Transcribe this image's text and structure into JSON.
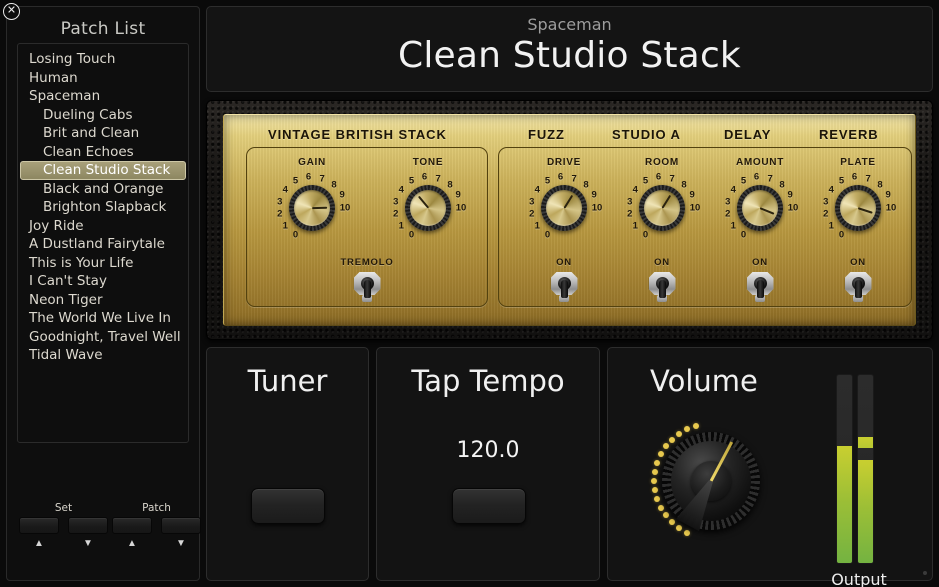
{
  "window": {
    "close_icon": "close-icon"
  },
  "sidebar": {
    "title": "Patch List",
    "items": [
      {
        "label": "Losing Touch",
        "child": false,
        "selected": false
      },
      {
        "label": "Human",
        "child": false,
        "selected": false
      },
      {
        "label": "Spaceman",
        "child": false,
        "selected": false
      },
      {
        "label": "Dueling Cabs",
        "child": true,
        "selected": false
      },
      {
        "label": "Brit and Clean",
        "child": true,
        "selected": false
      },
      {
        "label": "Clean Echoes",
        "child": true,
        "selected": false
      },
      {
        "label": "Clean Studio Stack",
        "child": true,
        "selected": true
      },
      {
        "label": "Black and Orange",
        "child": true,
        "selected": false
      },
      {
        "label": "Brighton Slapback",
        "child": true,
        "selected": false
      },
      {
        "label": "Joy Ride",
        "child": false,
        "selected": false
      },
      {
        "label": "A Dustland Fairytale",
        "child": false,
        "selected": false
      },
      {
        "label": "This is Your Life",
        "child": false,
        "selected": false
      },
      {
        "label": "I Can't Stay",
        "child": false,
        "selected": false
      },
      {
        "label": "Neon Tiger",
        "child": false,
        "selected": false
      },
      {
        "label": "The World We Live In",
        "child": false,
        "selected": false
      },
      {
        "label": "Goodnight, Travel Well",
        "child": false,
        "selected": false
      },
      {
        "label": "Tidal Wave",
        "child": false,
        "selected": false
      }
    ],
    "transport": {
      "set_label": "Set",
      "patch_label": "Patch",
      "up_arrow": "▲",
      "down_arrow": "▼"
    }
  },
  "header": {
    "subtitle": "Spaceman",
    "title": "Clean Studio Stack"
  },
  "amp": {
    "name": "VINTAGE BRITISH STACK",
    "knobs": [
      {
        "label": "GAIN",
        "angle": 268
      },
      {
        "label": "TONE",
        "angle": 140
      }
    ],
    "switch": {
      "label": "TREMOLO"
    },
    "scale_ticks": [
      "0",
      "1",
      "2",
      "3",
      "4",
      "5",
      "6",
      "7",
      "8",
      "9",
      "10"
    ]
  },
  "effects": [
    {
      "name": "FUZZ",
      "knob_label": "DRIVE",
      "angle": 212,
      "switch_label": "ON"
    },
    {
      "name": "STUDIO A",
      "knob_label": "ROOM",
      "angle": 212,
      "switch_label": "ON"
    },
    {
      "name": "DELAY",
      "knob_label": "AMOUNT",
      "angle": 292,
      "switch_label": "ON"
    },
    {
      "name": "REVERB",
      "knob_label": "PLATE",
      "angle": 288,
      "switch_label": "ON"
    }
  ],
  "tuner": {
    "title": "Tuner"
  },
  "tap_tempo": {
    "title": "Tap Tempo",
    "value": "120.0"
  },
  "volume": {
    "title": "Volume",
    "knob_angle": 208,
    "output_label": "Output",
    "meter_left_pct": 62,
    "meter_right_pct": 55,
    "meter_right_peak_top_pct": 61,
    "meter_right_peak_height_pct": 6
  },
  "colors": {
    "accent_gold": "#e8c94e",
    "selection": "#97906a",
    "meter_green": "#74b341",
    "panel_bg": "#131313",
    "faceplate_gold": "#cdb35c"
  }
}
